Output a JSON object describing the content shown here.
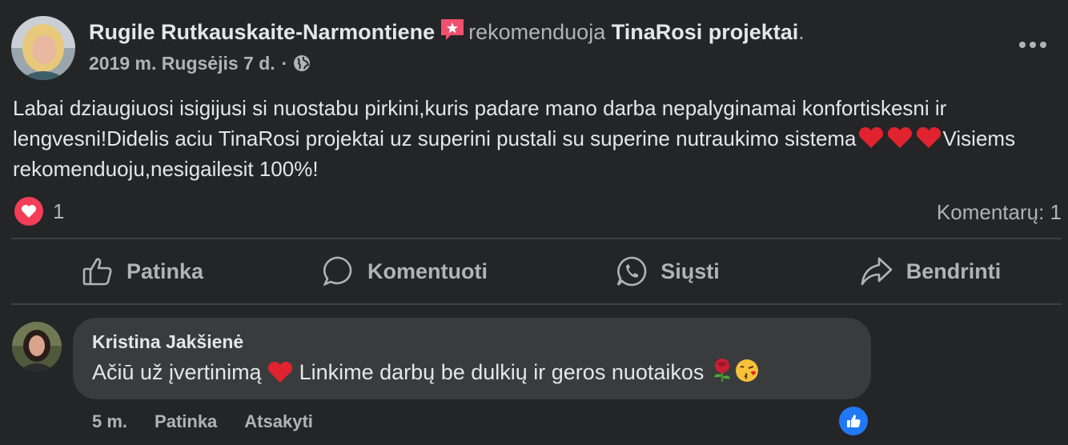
{
  "post": {
    "author": "Rugile Rutkauskaite-Narmontiene",
    "verb": "rekomenduoja",
    "page": "TinaRosi projektai",
    "period": ".",
    "date": "2019 m. Rugsėjis 7 d.",
    "separator": "·",
    "privacy_icon": "globe-icon",
    "more_icon": "more-options-icon",
    "text_part1": "Labai dziaugiuosi isigijusi si nuostabu pirkini,kuris padare mano darba nepalyginamai konfortiskesni ir lengvesni!Didelis aciu TinaRosi projektai uz superini pustali su superine nutraukimo sistema",
    "text_part2": "Visiems rekomenduoju,nesigailesit 100%!",
    "reaction_icon": "love-reaction-icon",
    "reaction_count": "1",
    "comments_count": "Komentarų: 1"
  },
  "actions": {
    "like": "Patinka",
    "comment": "Komentuoti",
    "send": "Siųsti",
    "share": "Bendrinti"
  },
  "comment": {
    "author": "Kristina Jakšienė",
    "text_part1": "Ačiū už įvertinimą",
    "text_part2": "Linkime darbų be dulkių ir geros nuotaikos",
    "time": "5 m.",
    "like": "Patinka",
    "reply": "Atsakyti",
    "reaction_icon": "like-reaction-icon"
  },
  "colors": {
    "background": "#242526",
    "bubble": "#3a3b3c",
    "text": "#e4e6eb",
    "secondary": "#b0b3b8",
    "love": "#f33e58",
    "like": "#2078f4"
  }
}
